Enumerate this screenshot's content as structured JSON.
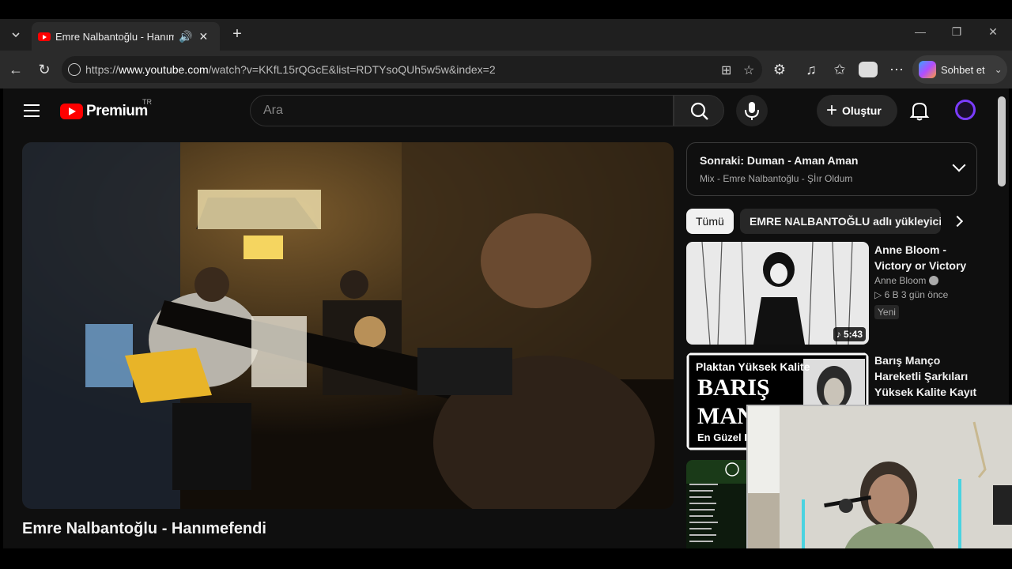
{
  "browser": {
    "tab_title": "Emre Nalbantoğlu - Hanımefendi",
    "url_prefix": "https://",
    "url_host": "www.youtube.com",
    "url_path": "/watch?v=KKfL15rQGcE&list=RDTYsoQUh5w5w&index=2",
    "copilot_label": "Sohbet et"
  },
  "youtube": {
    "logo_text": "Premium",
    "country_code": "TR",
    "search_placeholder": "Ara",
    "create_label": "Oluştur",
    "video_title": "Emre Nalbantoğlu - Hanımefendi",
    "up_next": {
      "title": "Sonraki: Duman - Aman Aman",
      "subtitle": "Mix - Emre Nalbantoğlu - Şİır Oldum"
    },
    "chips": [
      "Tümü",
      "EMRE NALBANTOĞLU adlı yükleyiciden"
    ],
    "recommendations": [
      {
        "title": "Anne Bloom - Victory or Victory",
        "channel": "Anne Bloom",
        "stats": "▷ 6 B   3 gün önce",
        "badge": "Yeni",
        "duration": "♪ 5:43"
      },
      {
        "title": "Barış Manço Hareketli Şarkıları Yüksek Kalite Kayıt",
        "thumb_text_top": "Plaktan Yüksek Kalite",
        "thumb_text_big": "BARIŞ",
        "thumb_text_big2": "MAN",
        "thumb_text_small": "En Güzel H"
      }
    ]
  },
  "colors": {
    "yt_red": "#ff0000",
    "bg": "#0f0f0f",
    "chrome": "#2b2b2b"
  }
}
